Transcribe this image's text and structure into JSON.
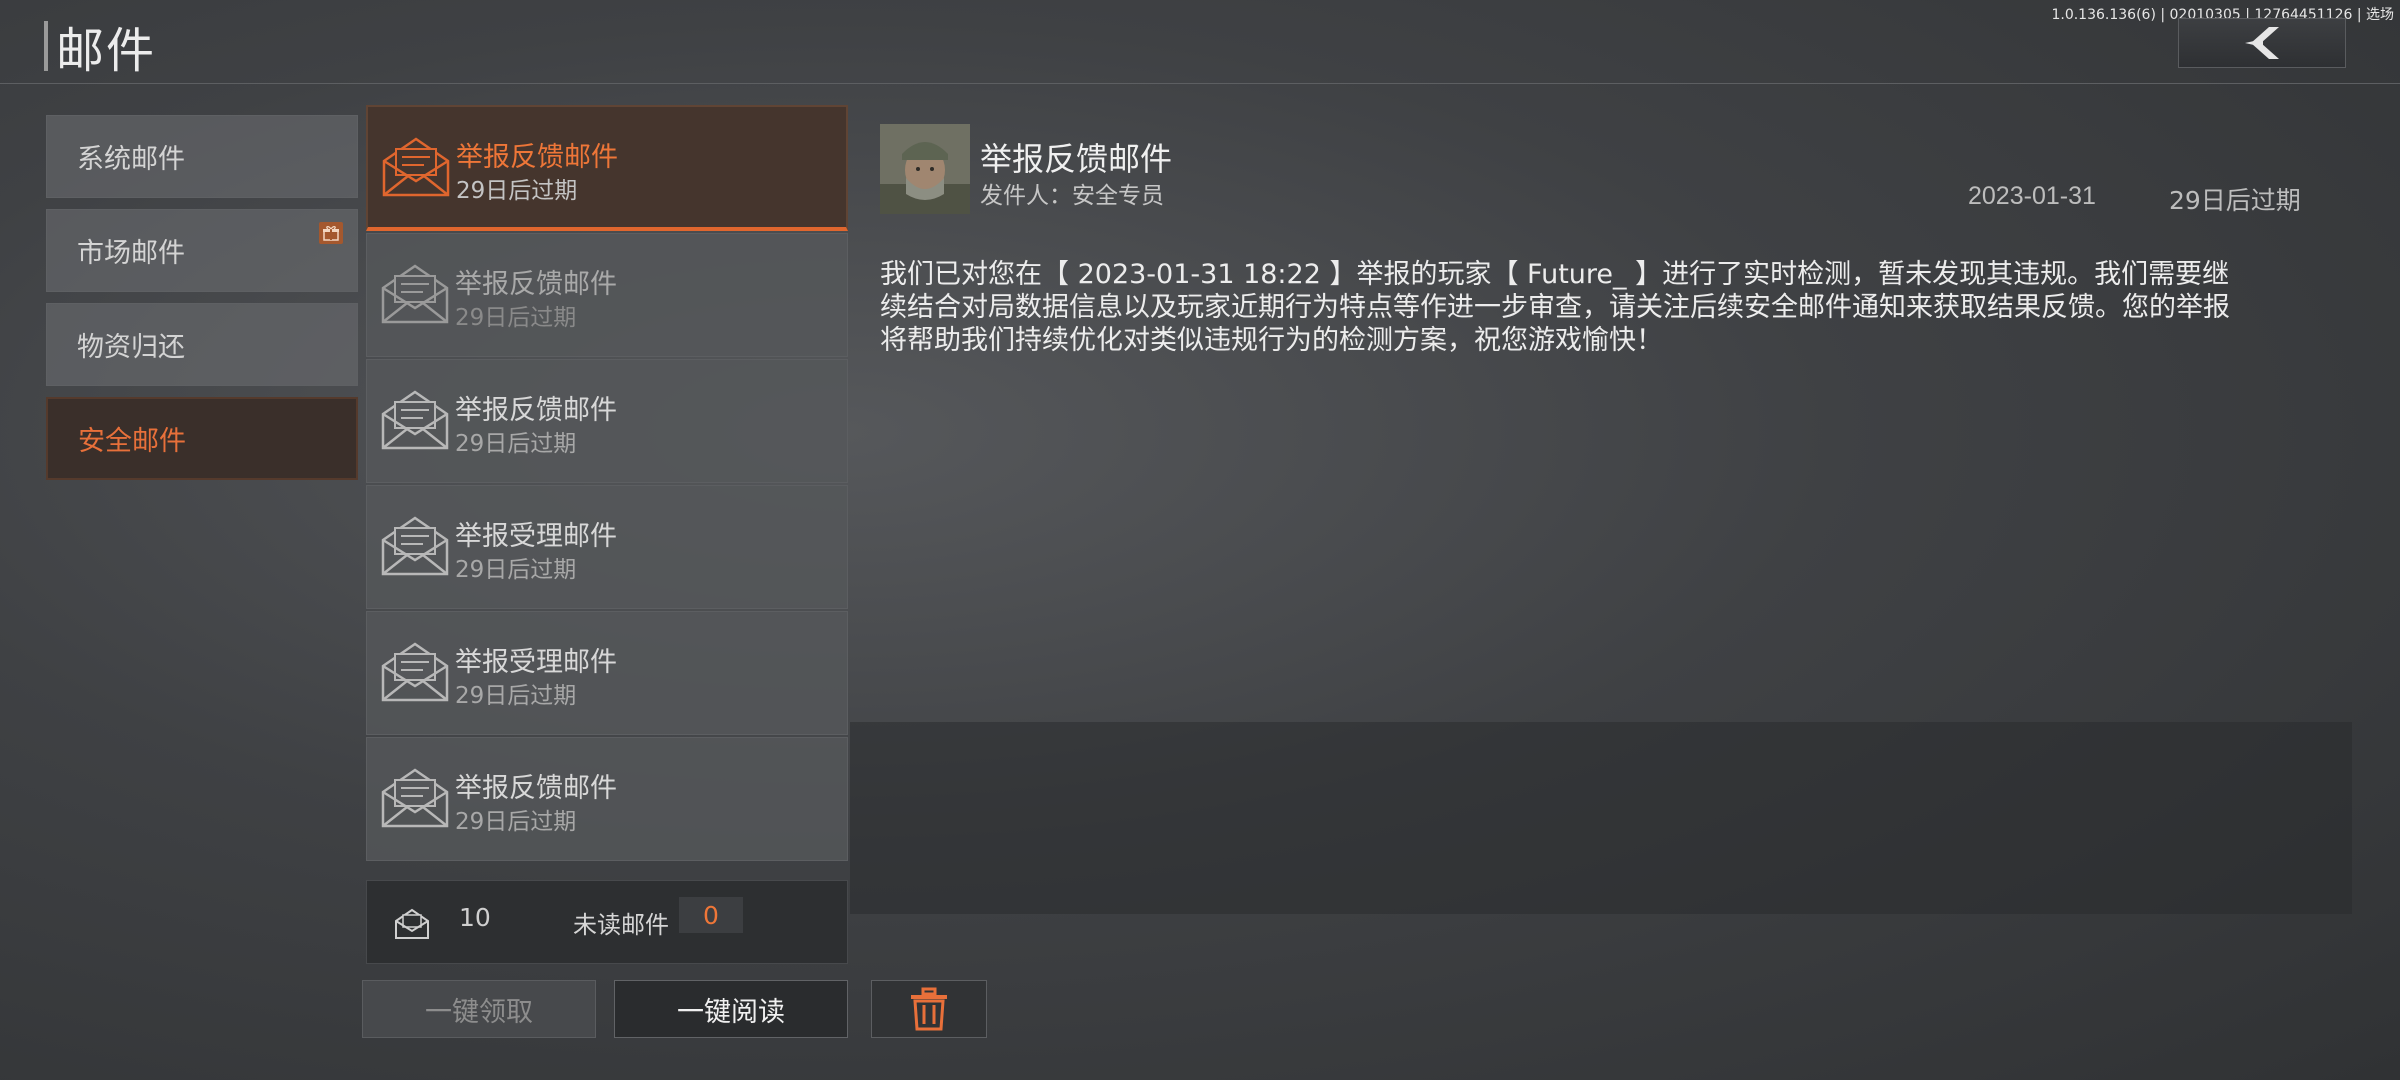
{
  "version": "1.0.136.136(6) | 02010305 | 12764451126 | 选场",
  "page_title": "邮件",
  "icons": {
    "back": "chevron-left-icon",
    "mail": "envelope-open-icon",
    "gift": "gift-icon",
    "delete": "trash-icon"
  },
  "colors": {
    "accent": "#e8703a",
    "background": "#3f4144"
  },
  "categories": [
    {
      "label": "系统邮件",
      "active": false
    },
    {
      "label": "市场邮件",
      "active": false,
      "badge": "gift"
    },
    {
      "label": "物资归还",
      "active": false
    },
    {
      "label": "安全邮件",
      "active": true
    }
  ],
  "mails": [
    {
      "title": "举报反馈邮件",
      "expire": "29日后过期"
    },
    {
      "title": "举报反馈邮件",
      "expire": "29日后过期"
    },
    {
      "title": "举报反馈邮件",
      "expire": "29日后过期"
    },
    {
      "title": "举报受理邮件",
      "expire": "29日后过期"
    },
    {
      "title": "举报受理邮件",
      "expire": "29日后过期"
    },
    {
      "title": "举报反馈邮件",
      "expire": "29日后过期"
    }
  ],
  "footer": {
    "count": "10",
    "unread_label": "未读邮件",
    "unread_count": "0"
  },
  "buttons": {
    "claim_all": "一键领取",
    "read_all": "一键阅读"
  },
  "detail": {
    "title": "举报反馈邮件",
    "sender": "发件人：安全专员",
    "date": "2023-01-31",
    "expire": "29日后过期",
    "body_lines": [
      "我们已对您在【 2023-01-31 18:22 】举报的玩家【 Future_ 】进行了实时检测，暂未发现其违规。我们需要继",
      "续结合对局数据信息以及玩家近期行为特点等作进一步审查，请关注后续安全邮件通知来获取结果反馈。您的举报",
      "将帮助我们持续优化对类似违规行为的检测方案，祝您游戏愉快！"
    ]
  }
}
